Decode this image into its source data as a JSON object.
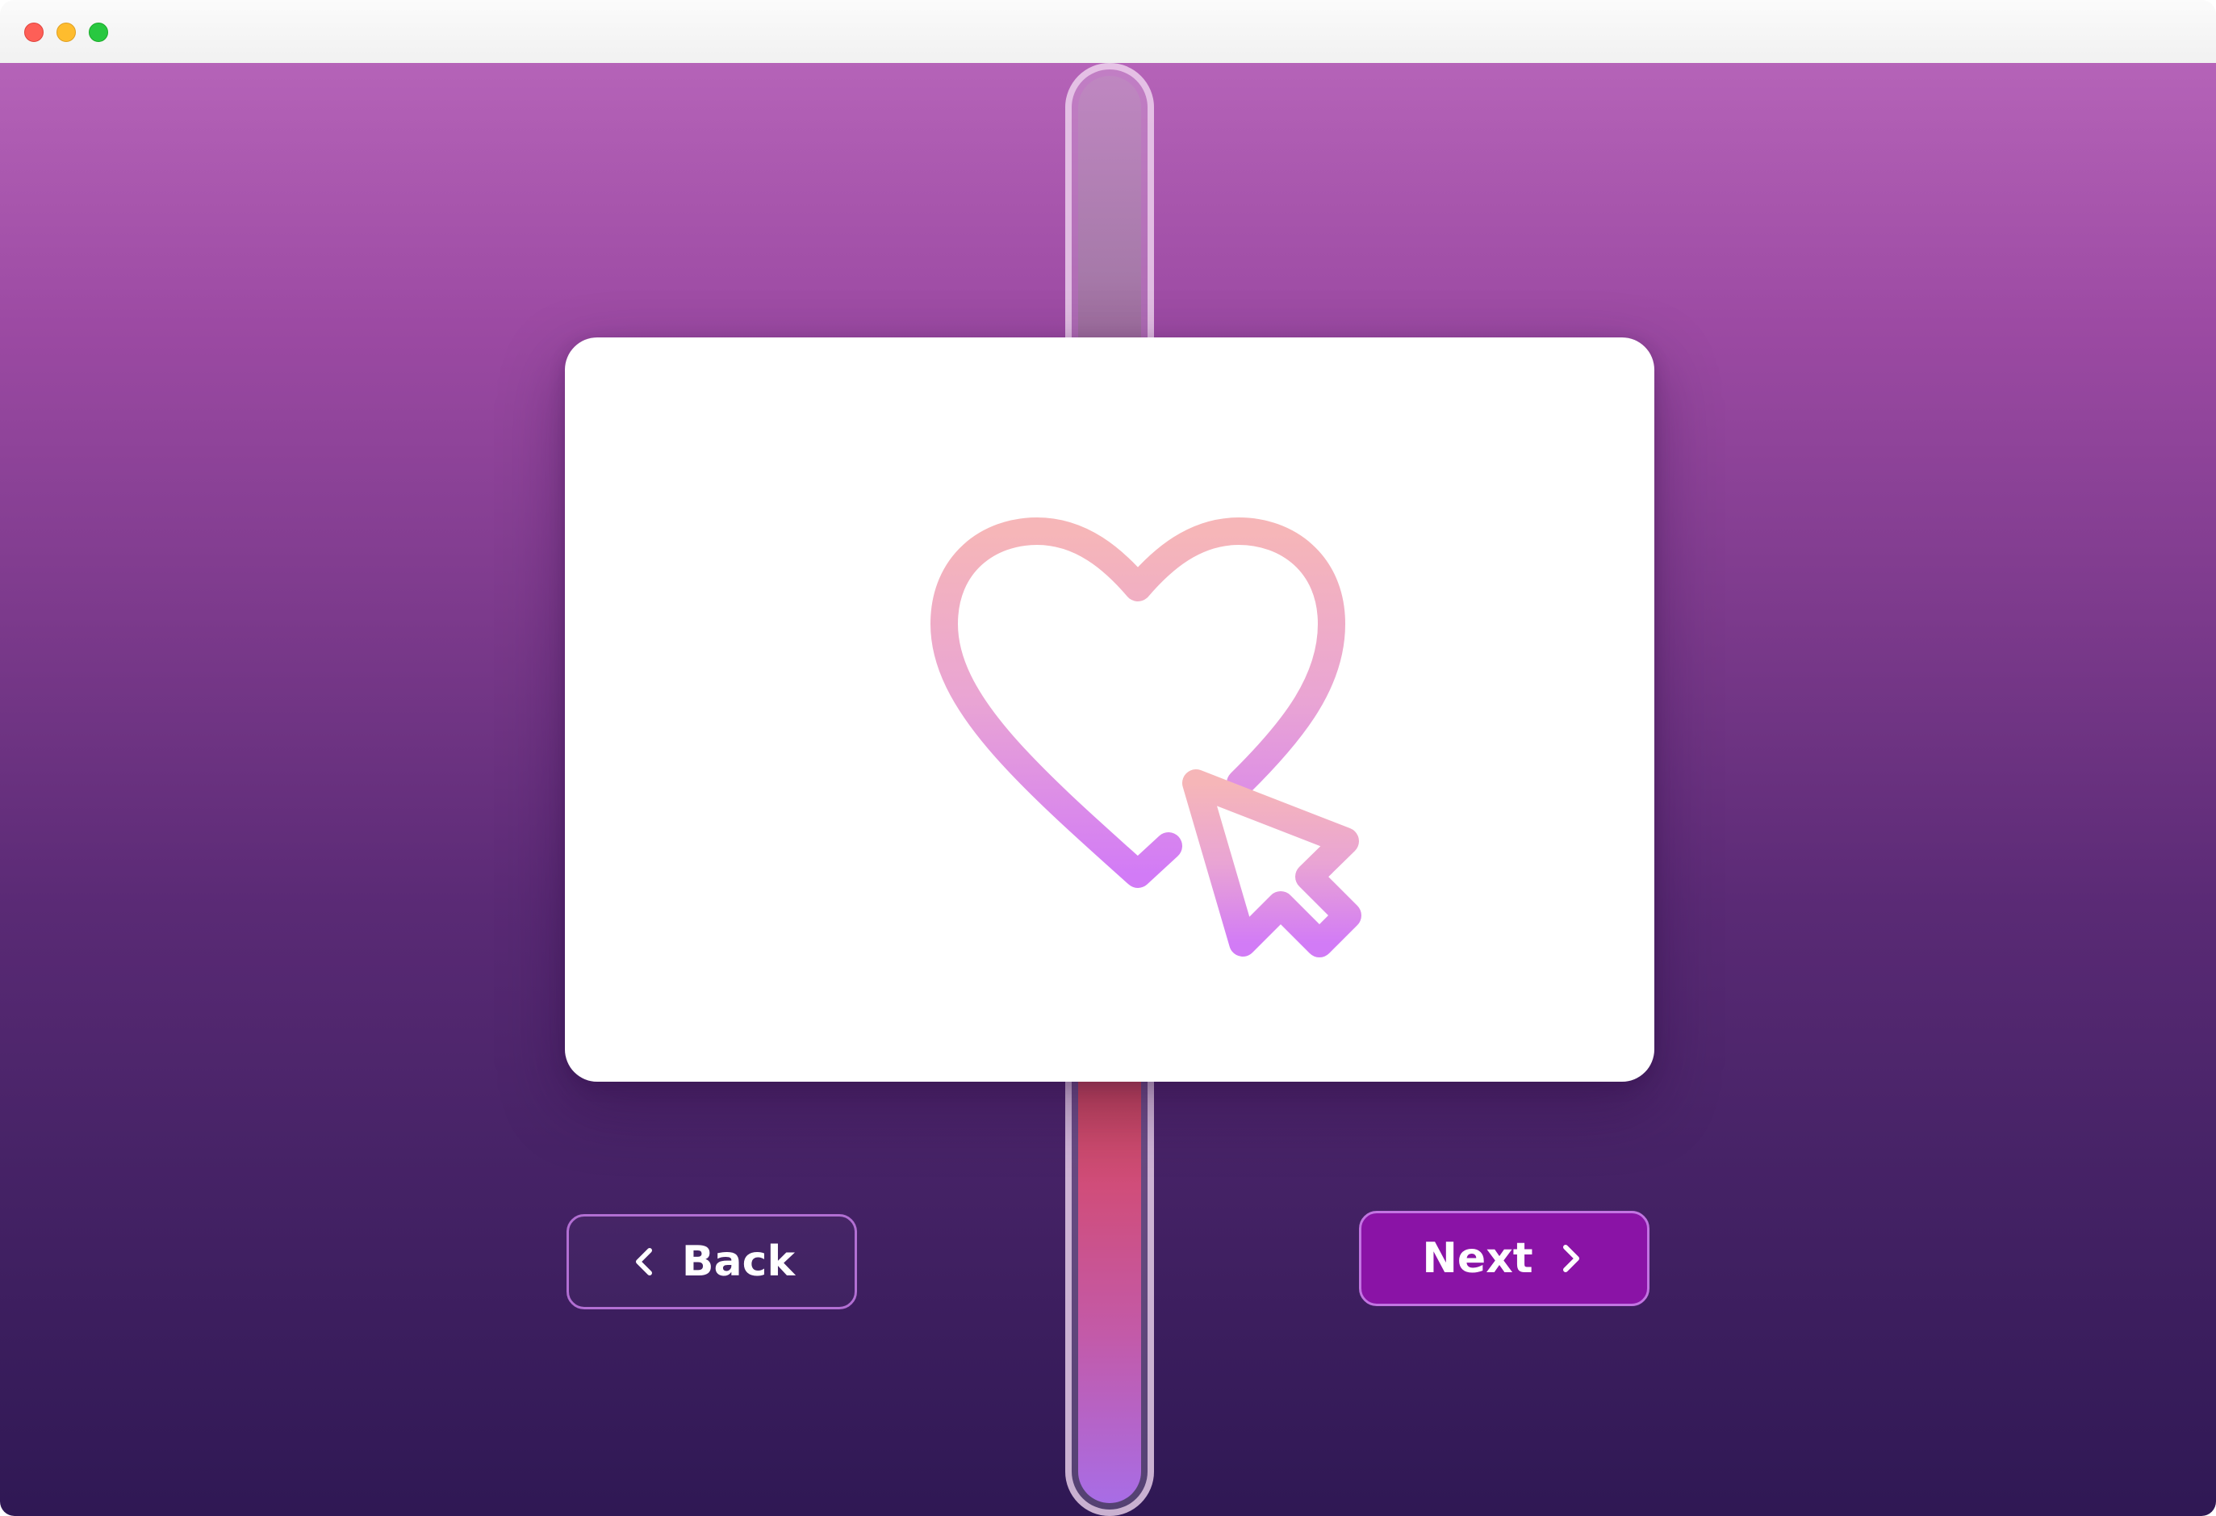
{
  "window": {
    "controls": [
      "close",
      "minimize",
      "maximize"
    ]
  },
  "progress": {
    "fill_fraction": 0.29
  },
  "card": {
    "illustration": "heart-with-cursor-icon",
    "gradient_colors": [
      "#f6b6b8",
      "#e9a4d4",
      "#d27bf6"
    ]
  },
  "navigation": {
    "back_label": "Back",
    "next_label": "Next"
  },
  "colors": {
    "background_top": "#b563b8",
    "background_bottom": "#2f1854",
    "next_button": "#8a13a6",
    "back_border": "#b26fd3"
  }
}
